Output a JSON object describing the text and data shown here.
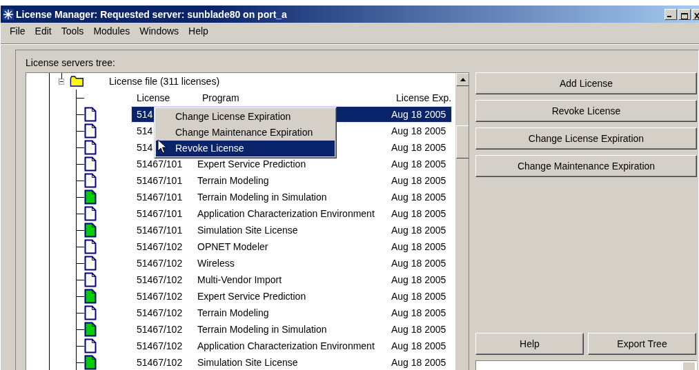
{
  "window": {
    "title": "License Manager: Requested server: sunblade80 on port_a"
  },
  "menu": [
    "File",
    "Edit",
    "Tools",
    "Modules",
    "Windows",
    "Help"
  ],
  "tree_label": "License servers tree:",
  "folder": {
    "label": "License file (311 licenses)",
    "expanded": true
  },
  "columns": [
    "License",
    "Program",
    "License Exp."
  ],
  "rows": [
    {
      "license": "514",
      "program": "",
      "expiration": "Aug 18 2005",
      "kind": "blank",
      "selected": true
    },
    {
      "license": "514",
      "program": "",
      "expiration": "Aug 18 2005",
      "kind": "blank",
      "selected": false
    },
    {
      "license": "514",
      "program": "",
      "expiration": "Aug 18 2005",
      "kind": "blank",
      "selected": false
    },
    {
      "license": "51467/101",
      "program": "Expert Service Prediction",
      "expiration": "Aug 18 2005",
      "kind": "blank",
      "selected": false
    },
    {
      "license": "51467/101",
      "program": "Terrain Modeling",
      "expiration": "Aug 18 2005",
      "kind": "blank",
      "selected": false
    },
    {
      "license": "51467/101",
      "program": "Terrain Modeling in Simulation",
      "expiration": "Aug 18 2005",
      "kind": "green",
      "selected": false
    },
    {
      "license": "51467/101",
      "program": "Application Characterization Environment",
      "expiration": "Aug 18 2005",
      "kind": "blank",
      "selected": false
    },
    {
      "license": "51467/101",
      "program": "Simulation Site License",
      "expiration": "Aug 18 2005",
      "kind": "green",
      "selected": false
    },
    {
      "license": "51467/102",
      "program": "OPNET Modeler",
      "expiration": "Aug 18 2005",
      "kind": "blank",
      "selected": false
    },
    {
      "license": "51467/102",
      "program": "Wireless",
      "expiration": "Aug 18 2005",
      "kind": "blank",
      "selected": false
    },
    {
      "license": "51467/102",
      "program": "Multi-Vendor Import",
      "expiration": "Aug 18 2005",
      "kind": "blank",
      "selected": false
    },
    {
      "license": "51467/102",
      "program": "Expert Service Prediction",
      "expiration": "Aug 18 2005",
      "kind": "green",
      "selected": false
    },
    {
      "license": "51467/102",
      "program": "Terrain Modeling",
      "expiration": "Aug 18 2005",
      "kind": "blank",
      "selected": false
    },
    {
      "license": "51467/102",
      "program": "Terrain Modeling in Simulation",
      "expiration": "Aug 18 2005",
      "kind": "green",
      "selected": false
    },
    {
      "license": "51467/102",
      "program": "Application Characterization Environment",
      "expiration": "Aug 18 2005",
      "kind": "blank",
      "selected": false
    },
    {
      "license": "51467/102",
      "program": "Simulation Site License",
      "expiration": "Aug 18 2005",
      "kind": "green",
      "selected": false
    }
  ],
  "context_menu": [
    {
      "label": "Change License Expiration",
      "selected": false
    },
    {
      "label": "Change Maintenance Expiration",
      "selected": false
    },
    {
      "label": "Revoke License",
      "selected": true
    }
  ],
  "actions": [
    "Add License",
    "Revoke License",
    "Change License Expiration",
    "Change Maintenance Expiration"
  ],
  "bottom_buttons": [
    "Help",
    "Export Tree"
  ]
}
